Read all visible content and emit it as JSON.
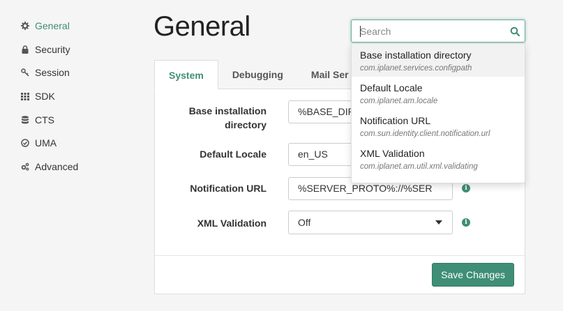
{
  "sidebar": {
    "items": [
      {
        "label": "General",
        "icon": "gear-icon",
        "active": true
      },
      {
        "label": "Security",
        "icon": "lock-icon",
        "active": false
      },
      {
        "label": "Session",
        "icon": "key-icon",
        "active": false
      },
      {
        "label": "SDK",
        "icon": "grid-icon",
        "active": false
      },
      {
        "label": "CTS",
        "icon": "database-icon",
        "active": false
      },
      {
        "label": "UMA",
        "icon": "check-circle-icon",
        "active": false
      },
      {
        "label": "Advanced",
        "icon": "gears-icon",
        "active": false
      }
    ]
  },
  "page_title": "General",
  "tabs": [
    {
      "label": "System",
      "active": true
    },
    {
      "label": "Debugging",
      "active": false
    },
    {
      "label": "Mail Ser",
      "active": false
    }
  ],
  "form": {
    "base_dir": {
      "label_line1": "Base installation",
      "label_line2": "directory",
      "value": "%BASE_DIR"
    },
    "locale": {
      "label": "Default Locale",
      "value": "en_US"
    },
    "notification": {
      "label": "Notification URL",
      "value": "%SERVER_PROTO%://%SER"
    },
    "xml": {
      "label": "XML Validation",
      "value": "Off"
    }
  },
  "save_label": "Save Changes",
  "search": {
    "placeholder": "Search",
    "results": [
      {
        "title": "Base installation directory",
        "sub": "com.iplanet.services.configpath"
      },
      {
        "title": "Default Locale",
        "sub": "com.iplanet.am.locale"
      },
      {
        "title": "Notification URL",
        "sub": "com.sun.identity.client.notification.url"
      },
      {
        "title": "XML Validation",
        "sub": "com.iplanet.am.util.xml.validating"
      }
    ]
  },
  "colors": {
    "accent": "#3f8e76",
    "active_text": "#3f8e76"
  }
}
